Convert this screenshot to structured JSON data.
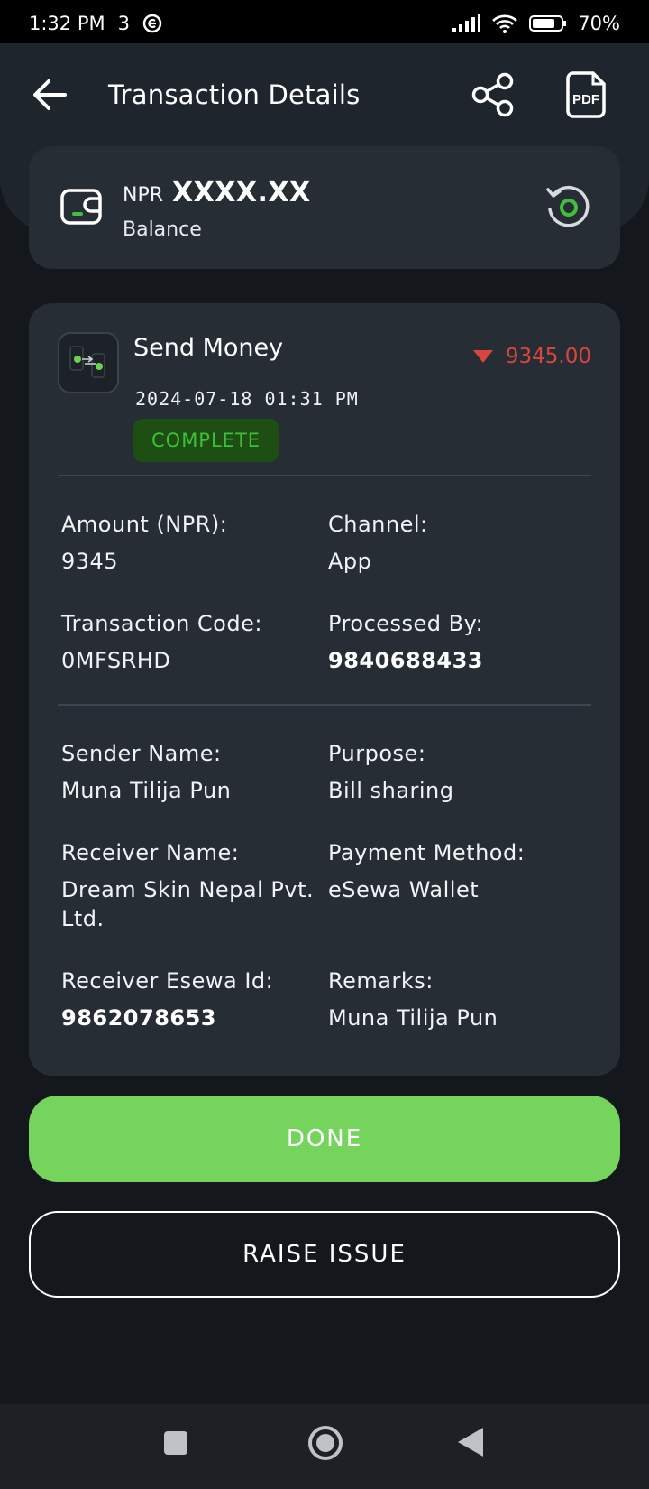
{
  "status_bar": {
    "time": "1:32 PM",
    "battery": "70",
    "icons": [
      "notification-3-icon",
      "esewa-status-icon",
      "signal-icon",
      "wifi-icon",
      "battery-icon"
    ]
  },
  "header": {
    "title": "Transaction Details",
    "icons": [
      "back-arrow-icon",
      "share-icon",
      "pdf-icon"
    ],
    "pdf_icon_text": "PDF"
  },
  "balance": {
    "currency": "NPR",
    "amount": "XXXX.XX",
    "label": "Balance",
    "icons": [
      "wallet-icon",
      "refresh-icon"
    ]
  },
  "transaction": {
    "service": "Send Money",
    "amount": "9345.00",
    "datetime": "2024-07-18 01:31 PM",
    "status": "COMPLETE",
    "fields_group1": [
      {
        "label": "Amount (NPR):",
        "value": "9345"
      },
      {
        "label": "Channel:",
        "value": "App"
      },
      {
        "label": "Transaction Code:",
        "value": "0MFSRHD"
      },
      {
        "label": "Processed By:",
        "value": "9840688433"
      }
    ],
    "fields_group2": [
      {
        "label": "Sender Name:",
        "value": "Muna Tilija Pun"
      },
      {
        "label": "Purpose:",
        "value": "Bill sharing"
      },
      {
        "label": "Receiver Name:",
        "value": "Dream Skin Nepal Pvt. Ltd."
      },
      {
        "label": "Payment Method:",
        "value": "eSewa Wallet"
      },
      {
        "label": "Receiver Esewa Id:",
        "value": "9862078653"
      },
      {
        "label": "Remarks:",
        "value": "Muna Tilija Pun"
      }
    ]
  },
  "buttons": {
    "done": "DONE",
    "raise_issue": "RAISE ISSUE"
  },
  "colors": {
    "background": "#14171b",
    "card": "#262d35",
    "accent_green": "#74d45c",
    "debit_red": "#d9463b",
    "status_green": "#3fbf3b"
  },
  "nav": {
    "icons": [
      "recent-apps-icon",
      "home-icon",
      "back-icon"
    ]
  }
}
